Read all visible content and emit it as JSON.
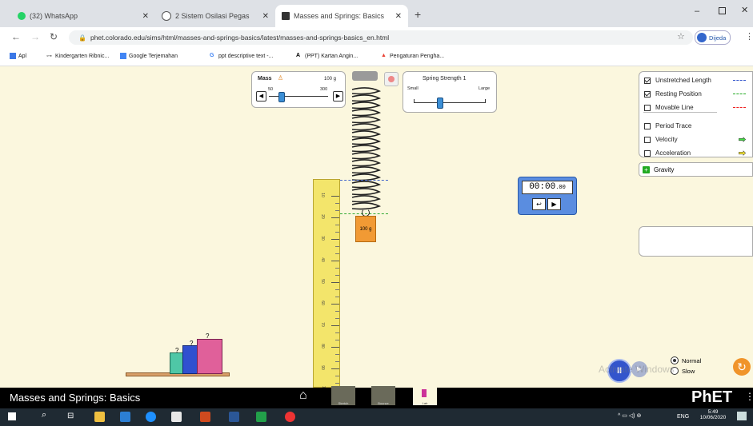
{
  "browser": {
    "tabs": [
      {
        "label": "(32) WhatsApp",
        "color": "#25d366"
      },
      {
        "label": "2 Sistem Osilasi Pegas",
        "color": "#555555"
      },
      {
        "label": "Masses and Springs: Basics",
        "color": "#222222"
      }
    ],
    "new_tab": "+",
    "url": "phet.colorado.edu/sims/html/masses-and-springs-basics/latest/masses-and-springs-basics_en.html",
    "profile_label": "Dijeda",
    "bookmarks": [
      "Apl",
      "Kindergarten Ribnic...",
      "Google Terjemahan",
      "ppt descriptive text -...",
      "(PPT) Kartan Angin...",
      "Pengaturan Pengha..."
    ]
  },
  "mass_panel": {
    "title": "Mass",
    "value": "100 g",
    "min_label": "50",
    "max_label": "300",
    "level": 0.2
  },
  "spring_panel": {
    "title": "Spring Strength 1",
    "small_label": "Small",
    "large_label": "Large",
    "level": 0.35
  },
  "hanging_mass_label": "100 g",
  "ruler_ticks": [
    "10",
    "20",
    "30",
    "40",
    "50",
    "60",
    "70",
    "80",
    "90",
    "100"
  ],
  "options": [
    {
      "label": "Unstretched Length",
      "checked": true,
      "indicator": "dashed-blue",
      "color": "#3355cc"
    },
    {
      "label": "Resting Position",
      "checked": true,
      "indicator": "dashed-green",
      "color": "#22aa22"
    },
    {
      "label": "Movable Line",
      "checked": false,
      "indicator": "dashed-red",
      "color": "#ee2222"
    },
    {
      "label": "Period Trace",
      "checked": false,
      "indicator": "",
      "color": ""
    },
    {
      "label": "Velocity",
      "checked": false,
      "indicator": "green-arrow",
      "color": "#44dd44"
    },
    {
      "label": "Acceleration",
      "checked": false,
      "indicator": "yellow-arrow",
      "color": "#ffee33"
    }
  ],
  "gravity_label": "Gravity",
  "timer": {
    "time": "00:00",
    "fraction": ".00"
  },
  "speed": {
    "normal_label": "Normal",
    "slow_label": "Slow",
    "selected": "Normal"
  },
  "sim_title": "Masses and Springs: Basics",
  "nav_screens": [
    {
      "label": "Stretch"
    },
    {
      "label": "Bounce"
    },
    {
      "label": "Lab"
    }
  ],
  "phet_logo": "PhET",
  "activate_watermark": "Activate Windows",
  "taskbar": {
    "language": "ENG",
    "time": "5:49",
    "date": "10/06/2020"
  }
}
